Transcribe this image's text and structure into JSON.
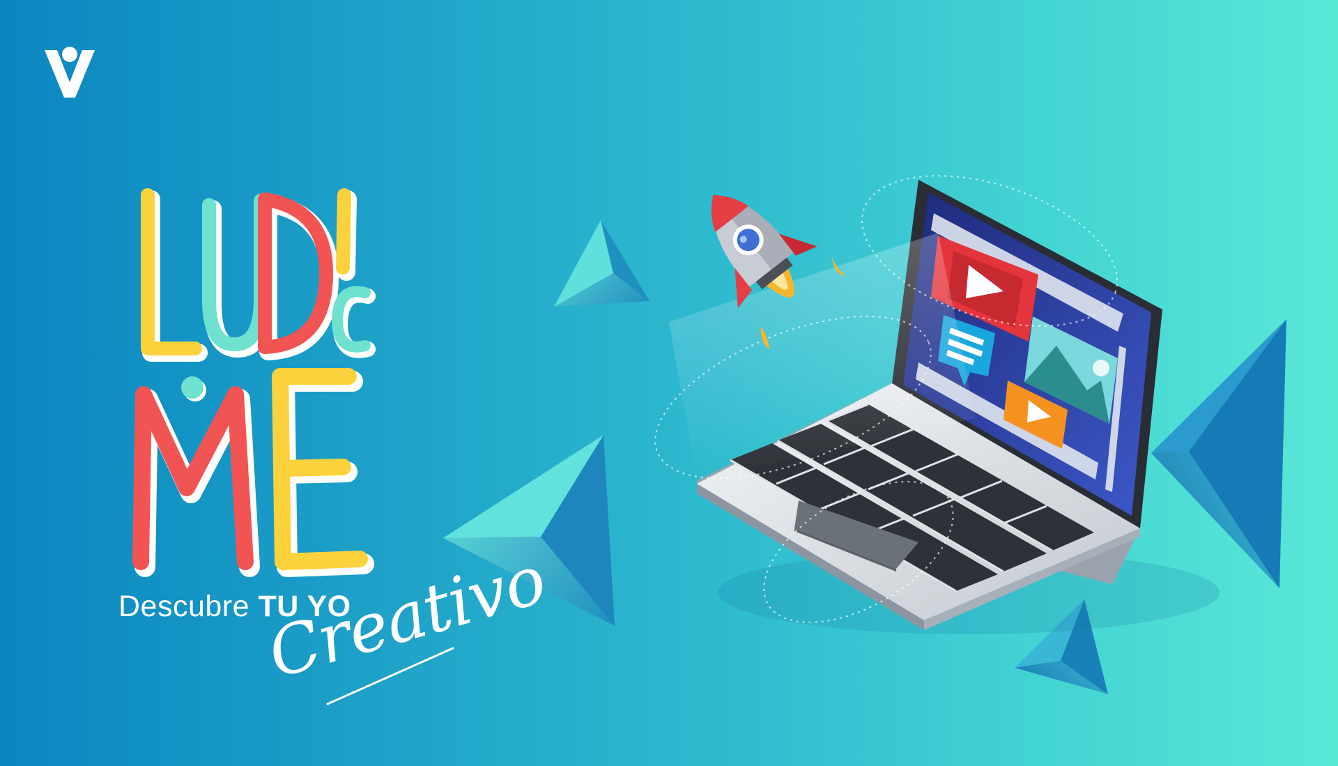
{
  "brand": {
    "logo": "v-brand-logo",
    "colors": {
      "background_start": "#0a86c0",
      "background_end": "#5ae8d6",
      "yellow": "#fcd23c",
      "teal": "#6fe1cf",
      "red": "#f25454",
      "white": "#ffffff"
    }
  },
  "headline": {
    "line1": [
      "L",
      "U",
      "D",
      "I",
      "C"
    ],
    "line2": [
      "M",
      "E"
    ],
    "dot_color": "#6fe1cf"
  },
  "tagline": {
    "prefix": "Descubre ",
    "emphasis": "TU YO",
    "script": "Creativo"
  },
  "illustration": {
    "objects": [
      "rocket-icon",
      "laptop",
      "play-video-icon",
      "chat-bubble-icon",
      "image-icon",
      "pyramid-shapes"
    ]
  }
}
